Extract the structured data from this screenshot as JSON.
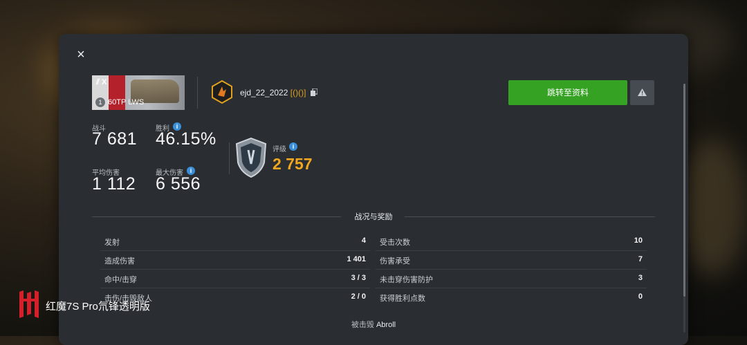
{
  "dialog": {
    "close_label": "×",
    "tank": {
      "tier": "X",
      "tier_badge": "1",
      "name": "60TP LWS"
    },
    "player": {
      "name": "ejd_22_2022",
      "clan": "[()()]"
    },
    "profile_button": "跳转至资料",
    "stats": {
      "battles_label": "战斗",
      "battles_value": "7 681",
      "winrate_label": "胜利",
      "winrate_value": "46.15%",
      "avg_damage_label": "平均伤害",
      "avg_damage_value": "1 112",
      "max_damage_label": "最大伤害",
      "max_damage_value": "6 556",
      "rating_label": "评级",
      "rating_value": "2 757"
    },
    "section_title": "战况与奖励",
    "battle_stats": {
      "left": [
        {
          "label": "发射",
          "value": "4"
        },
        {
          "label": "造成伤害",
          "value": "1 401"
        },
        {
          "label": "命中/击穿",
          "value": "3 / 3"
        },
        {
          "label": "击伤/击毁敌人",
          "value": "2 / 0"
        }
      ],
      "right": [
        {
          "label": "受击次数",
          "value": "10"
        },
        {
          "label": "伤害承受",
          "value": "7"
        },
        {
          "label": "未击穿伤害防护",
          "value": "3"
        },
        {
          "label": "获得胜利点数",
          "value": "0"
        }
      ]
    },
    "destroyed_by_label": "被击毁",
    "destroyed_by_value": "Abroll"
  },
  "watermark": {
    "text": "红魔7S Pro氘锋透明版"
  },
  "colors": {
    "accent_green": "#35a224",
    "rating_orange": "#f0a820",
    "info_blue": "#3a8fd8",
    "panel": "#2a2d31"
  }
}
